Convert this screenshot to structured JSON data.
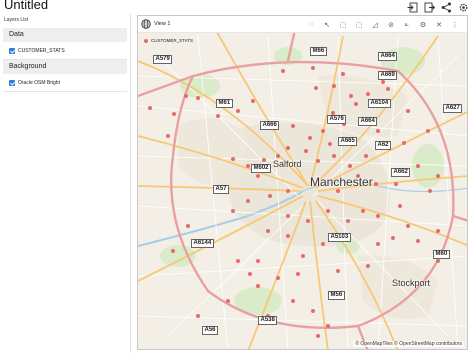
{
  "app": {
    "title": "Untitled"
  },
  "top_actions": [
    {
      "name": "import-icon",
      "glyph": "⇤"
    },
    {
      "name": "export-icon",
      "glyph": "⇥"
    },
    {
      "name": "share-icon",
      "glyph": "⋖"
    },
    {
      "name": "settings-icon",
      "glyph": "⚙"
    }
  ],
  "sidebar": {
    "layers_label": "Layers List",
    "sections": [
      {
        "title": "Data",
        "items": [
          {
            "label": "CUSTOMER_STATS",
            "checked": true
          }
        ]
      },
      {
        "title": "Background",
        "items": [
          {
            "label": "Oracle OSM Bright",
            "checked": true
          }
        ]
      }
    ]
  },
  "map": {
    "view_title": "View 1",
    "legend_label": "CUSTOMER_STATS",
    "point_color": "#e56b6b",
    "tools": [
      {
        "name": "pan-icon",
        "glyph": "◌"
      },
      {
        "name": "pointer-icon",
        "glyph": "↖"
      },
      {
        "name": "marquee-icon",
        "glyph": "⬚"
      },
      {
        "name": "zoom-box-icon",
        "glyph": "⬚"
      },
      {
        "name": "lasso-icon",
        "glyph": "◿"
      },
      {
        "name": "clear-selection-icon",
        "glyph": "⊘"
      },
      {
        "name": "measure-icon",
        "glyph": "⟀"
      },
      {
        "name": "map-settings-icon",
        "glyph": "⚙"
      },
      {
        "name": "close-icon",
        "glyph": "✕"
      },
      {
        "name": "more-icon",
        "glyph": "⋮"
      }
    ],
    "road_labels": [
      "A579",
      "M66",
      "A664",
      "A669",
      "A6104",
      "M61",
      "A666",
      "A576",
      "A664",
      "A627",
      "A665",
      "A62",
      "M602",
      "A662",
      "A57",
      "A6144",
      "A5103",
      "M60",
      "M56",
      "A538",
      "A56"
    ],
    "places": [
      "Salford",
      "Manchester",
      "Stockport"
    ],
    "attribution": "© OpenMapTiles © OpenStreetMap contributors"
  }
}
